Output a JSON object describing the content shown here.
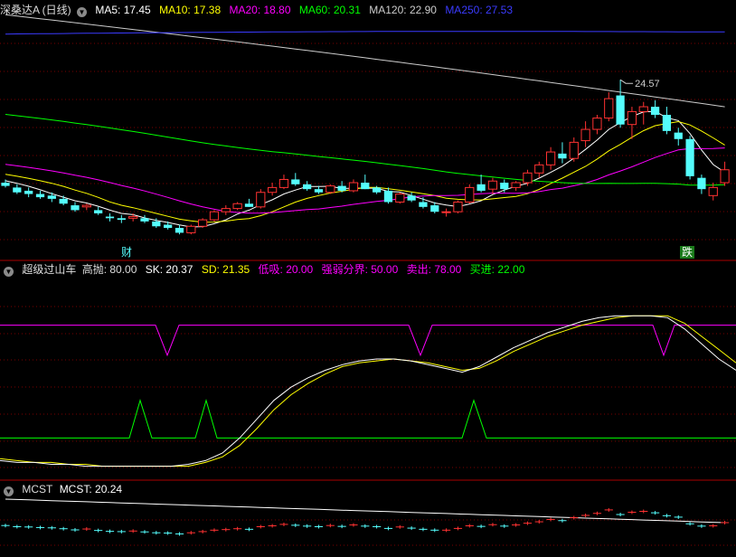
{
  "colors": {
    "ma5": "#ffffff",
    "ma10": "#ffff00",
    "ma20": "#ff00ff",
    "ma60": "#00ff00",
    "ma120": "#cccccc",
    "ma250": "#3b3bff",
    "up": "#ff3232",
    "down": "#54fcfc",
    "grid": "#7a0000",
    "border": "#aa0000",
    "title": "#dddddd"
  },
  "header": {
    "title": "深桑达A (日线)",
    "ma5": "MA5: 17.45",
    "ma10": "MA10: 17.38",
    "ma20": "MA20: 18.80",
    "ma60": "MA60: 20.31",
    "ma120": "MA120: 22.90",
    "ma250": "MA250: 27.53",
    "dropdown_icon": "chevron-down-icon"
  },
  "panel2": {
    "name": "超级过山车",
    "high": "高抛: 80.00",
    "sk": "SK: 20.37",
    "sd": "SD: 21.35",
    "low": "低吸: 20.00",
    "mid": "强弱分界: 50.00",
    "sell": "卖出: 78.00",
    "buy": "买进: 22.00"
  },
  "panel3": {
    "name": "MCST",
    "value": "MCST: 20.24"
  },
  "markers": {
    "cai": "财",
    "die": "跌"
  },
  "chart_data": [
    {
      "type": "candlestick",
      "high_label": "24.57",
      "series": [
        {
          "name": "MA5"
        },
        {
          "name": "MA10"
        },
        {
          "name": "MA20"
        },
        {
          "name": "MA60"
        },
        {
          "name": "MA120"
        },
        {
          "name": "MA250"
        }
      ],
      "candles_ohlc": [
        [
          18.2,
          18.4,
          17.9,
          18.0
        ],
        [
          17.9,
          18.1,
          17.5,
          17.6
        ],
        [
          17.7,
          17.9,
          17.3,
          17.5
        ],
        [
          17.5,
          17.7,
          17.2,
          17.3
        ],
        [
          17.4,
          17.6,
          17.0,
          17.2
        ],
        [
          17.2,
          17.4,
          16.8,
          16.9
        ],
        [
          16.8,
          17.0,
          16.4,
          16.5
        ],
        [
          16.7,
          16.9,
          16.5,
          16.8
        ],
        [
          16.5,
          16.7,
          16.2,
          16.3
        ],
        [
          16.1,
          16.3,
          15.8,
          16.0
        ],
        [
          16.0,
          16.2,
          15.7,
          15.9
        ],
        [
          16.0,
          16.3,
          15.8,
          16.1
        ],
        [
          16.0,
          16.2,
          15.7,
          15.8
        ],
        [
          15.8,
          16.0,
          15.4,
          15.5
        ],
        [
          15.6,
          15.8,
          15.3,
          15.4
        ],
        [
          15.4,
          15.6,
          15.0,
          15.1
        ],
        [
          15.1,
          15.6,
          15.0,
          15.5
        ],
        [
          15.5,
          16.0,
          15.4,
          15.9
        ],
        [
          15.9,
          16.5,
          15.8,
          16.4
        ],
        [
          16.4,
          16.8,
          16.2,
          16.6
        ],
        [
          16.6,
          17.0,
          16.5,
          16.9
        ],
        [
          16.9,
          17.2,
          16.7,
          16.7
        ],
        [
          16.7,
          17.8,
          16.6,
          17.6
        ],
        [
          17.6,
          18.2,
          17.4,
          17.9
        ],
        [
          17.9,
          18.7,
          17.8,
          18.4
        ],
        [
          18.4,
          18.8,
          18.0,
          18.1
        ],
        [
          18.1,
          18.3,
          17.7,
          17.8
        ],
        [
          17.8,
          18.0,
          17.5,
          17.6
        ],
        [
          17.6,
          18.1,
          17.5,
          18.0
        ],
        [
          18.0,
          18.3,
          17.6,
          17.7
        ],
        [
          17.7,
          18.4,
          17.6,
          18.2
        ],
        [
          18.2,
          18.7,
          17.8,
          17.8
        ],
        [
          17.9,
          18.0,
          17.5,
          17.6
        ],
        [
          17.7,
          17.9,
          16.9,
          17.0
        ],
        [
          17.0,
          17.6,
          16.9,
          17.5
        ],
        [
          17.4,
          17.6,
          17.0,
          17.1
        ],
        [
          17.0,
          17.3,
          16.6,
          16.7
        ],
        [
          16.8,
          17.0,
          16.3,
          16.4
        ],
        [
          16.4,
          16.6,
          16.1,
          16.4
        ],
        [
          16.4,
          17.1,
          16.3,
          17.0
        ],
        [
          17.0,
          18.1,
          16.9,
          17.9
        ],
        [
          18.1,
          18.7,
          17.6,
          17.7
        ],
        [
          17.8,
          18.5,
          17.5,
          18.3
        ],
        [
          18.2,
          18.4,
          17.6,
          17.8
        ],
        [
          17.9,
          18.3,
          17.7,
          18.2
        ],
        [
          18.2,
          19.0,
          18.0,
          18.8
        ],
        [
          18.8,
          19.5,
          18.5,
          19.3
        ],
        [
          19.3,
          20.4,
          19.0,
          20.1
        ],
        [
          20.0,
          20.7,
          19.4,
          19.7
        ],
        [
          19.7,
          21.0,
          19.5,
          20.7
        ],
        [
          20.8,
          22.0,
          20.4,
          21.5
        ],
        [
          21.5,
          22.4,
          21.2,
          22.2
        ],
        [
          22.2,
          23.8,
          22.0,
          23.4
        ],
        [
          23.6,
          24.57,
          21.6,
          21.8
        ],
        [
          21.8,
          22.9,
          20.9,
          22.6
        ],
        [
          22.6,
          23.2,
          21.8,
          22.9
        ],
        [
          22.9,
          23.3,
          22.2,
          22.4
        ],
        [
          22.4,
          22.9,
          21.2,
          21.4
        ],
        [
          21.3,
          21.6,
          20.5,
          20.9
        ],
        [
          20.9,
          21.1,
          18.4,
          18.6
        ],
        [
          18.5,
          18.7,
          17.5,
          17.8
        ],
        [
          17.4,
          18.2,
          17.1,
          17.9
        ],
        [
          18.2,
          19.5,
          18.0,
          19.0
        ]
      ]
    },
    {
      "type": "line",
      "series": [
        {
          "name": "SK",
          "values": [
            8,
            7,
            7,
            6,
            6,
            5,
            5,
            5,
            5,
            5,
            5,
            6,
            8,
            12,
            20,
            30,
            40,
            47,
            52,
            56,
            59,
            61,
            62,
            62,
            61,
            59,
            57,
            55,
            58,
            63,
            68,
            72,
            76,
            79,
            82,
            84,
            85,
            85,
            85,
            84,
            78,
            70,
            62,
            56
          ]
        },
        {
          "name": "SD",
          "values": [
            9,
            8,
            7,
            7,
            6,
            6,
            5,
            5,
            5,
            5,
            5,
            5,
            7,
            10,
            16,
            25,
            35,
            43,
            49,
            54,
            58,
            60,
            61,
            62,
            61,
            60,
            58,
            56,
            57,
            61,
            66,
            70,
            74,
            77,
            80,
            82,
            84,
            85,
            85,
            85,
            81,
            74,
            67,
            60
          ]
        }
      ],
      "reference_lines": [
        80,
        50,
        20
      ]
    },
    {
      "type": "candlestick",
      "series": [
        {
          "name": "MCST",
          "values": [
            22.8,
            20.24
          ]
        }
      ]
    }
  ]
}
